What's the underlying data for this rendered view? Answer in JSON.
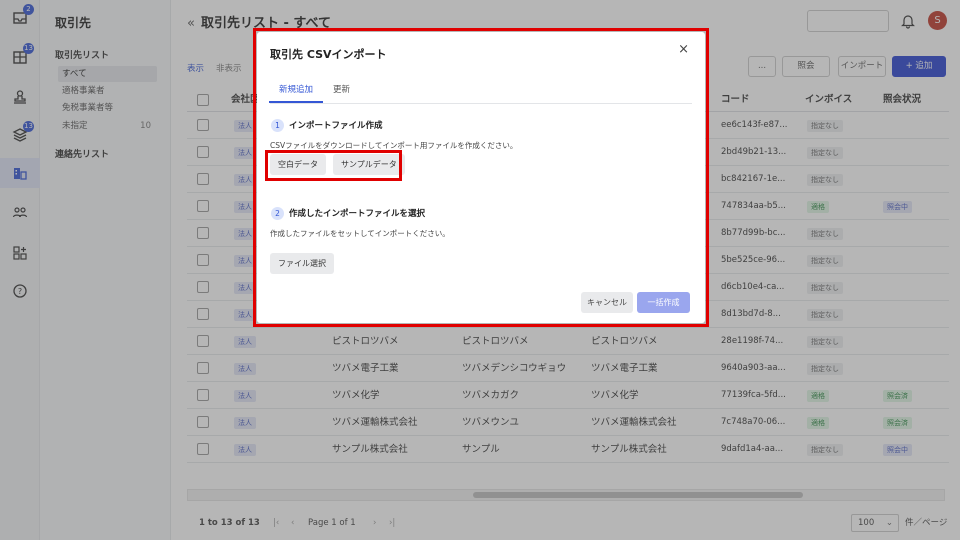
{
  "rail": {
    "badges": [
      "2",
      "13",
      "13"
    ]
  },
  "sidebar": {
    "title": "取引先",
    "group1": "取引先リスト",
    "items": [
      {
        "label": "すべて",
        "count": ""
      },
      {
        "label": "適格事業者",
        "count": ""
      },
      {
        "label": "免税事業者等",
        "count": ""
      },
      {
        "label": "未指定",
        "count": "10"
      }
    ],
    "group2": "連絡先リスト"
  },
  "header": {
    "back": "«",
    "title": "取引先リスト - すべて",
    "avatar": "S"
  },
  "toolbar": {
    "tab_display": "表示",
    "tab_hidden": "非表示",
    "more": "...",
    "confirm": "照会",
    "import": "インポート",
    "add": "+ 追加"
  },
  "table": {
    "columns": [
      "会社区",
      "コード",
      "インボイス",
      "照会状況"
    ],
    "rows": [
      {
        "type": "法人",
        "c1": "",
        "c2": "",
        "c3": "",
        "code": "ee6c143f-e87...",
        "invoice": "指定なし",
        "status": ""
      },
      {
        "type": "法人",
        "c1": "",
        "c2": "",
        "c3": "",
        "code": "2bd49b21-13...",
        "invoice": "指定なし",
        "status": ""
      },
      {
        "type": "法人",
        "c1": "",
        "c2": "",
        "c3": "",
        "code": "bc842167-1e...",
        "invoice": "指定なし",
        "status": ""
      },
      {
        "type": "法人",
        "c1": "",
        "c2": "",
        "c3": "",
        "code": "747834aa-b5...",
        "invoice": "適格",
        "status": "照会中"
      },
      {
        "type": "法人",
        "c1": "",
        "c2": "",
        "c3": "",
        "code": "8b77d99b-bc...",
        "invoice": "指定なし",
        "status": ""
      },
      {
        "type": "法人",
        "c1": "",
        "c2": "",
        "c3": "",
        "code": "5be525ce-96...",
        "invoice": "指定なし",
        "status": ""
      },
      {
        "type": "法人",
        "c1": "",
        "c2": "",
        "c3": "",
        "code": "d6cb10e4-ca...",
        "invoice": "指定なし",
        "status": ""
      },
      {
        "type": "法人",
        "c1": "",
        "c2": "",
        "c3": "",
        "code": "8d13bd7d-8...",
        "invoice": "指定なし",
        "status": ""
      },
      {
        "type": "法人",
        "c1": "ピストロツバメ",
        "c2": "ピストロツバメ",
        "c3": "ピストロツバメ",
        "code": "28e1198f-74...",
        "invoice": "指定なし",
        "status": ""
      },
      {
        "type": "法人",
        "c1": "ツバメ電子工業",
        "c2": "ツバメデンシコウギョウ",
        "c3": "ツバメ電子工業",
        "code": "9640a903-aa...",
        "invoice": "指定なし",
        "status": ""
      },
      {
        "type": "法人",
        "c1": "ツバメ化学",
        "c2": "ツバメカガク",
        "c3": "ツバメ化学",
        "code": "77139fca-5fd...",
        "invoice": "適格",
        "status": "照会済"
      },
      {
        "type": "法人",
        "c1": "ツバメ運輸株式会社",
        "c2": "ツバメウンユ",
        "c3": "ツバメ運輸株式会社",
        "code": "7c748a70-06...",
        "invoice": "適格",
        "status": "照会済"
      },
      {
        "type": "法人",
        "c1": "サンプル株式会社",
        "c2": "サンプル",
        "c3": "サンプル株式会社",
        "code": "9dafd1a4-aa...",
        "invoice": "指定なし",
        "status": "照会中"
      }
    ]
  },
  "pager": {
    "range": "1 to 13 of 13",
    "page": "Page 1 of 1",
    "size": "100",
    "unit": "件／ページ"
  },
  "modal": {
    "title": "取引先 CSVインポート",
    "close": "×",
    "tab_new": "新規追加",
    "tab_update": "更新",
    "step1_num": "1",
    "step1_title": "インポートファイル作成",
    "step1_desc": "CSVファイルをダウンロードしてインポート用ファイルを作成ください。",
    "btn_blank": "空白データ",
    "btn_sample": "サンプルデータ",
    "step2_num": "2",
    "step2_title": "作成したインポートファイルを選択",
    "step2_desc": "作成したファイルをセットしてインポートください。",
    "btn_file": "ファイル選択",
    "btn_cancel": "キャンセル",
    "btn_create": "一括作成"
  },
  "colors": {
    "accent": "#2a44d0",
    "highlight": "#e00000"
  }
}
